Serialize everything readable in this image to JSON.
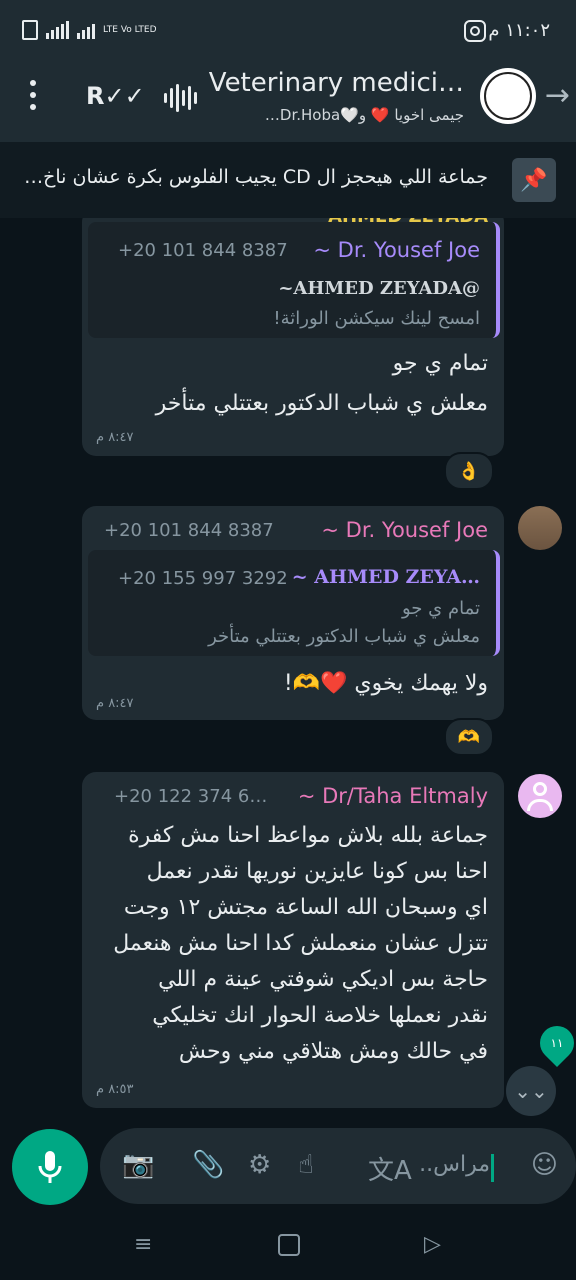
{
  "statusbar": {
    "time": "١١:٠٢ م",
    "network": "LTE Vo LTED"
  },
  "header": {
    "title": "Veterinary medici…",
    "subtitle": "جيمى اخويا ❤️ و🤍Dr.Hoba…"
  },
  "pinned": {
    "text": "جماعة اللي هيحجز ال CD يجيب الفلوس بكرة عشان ناخ…"
  },
  "messages": [
    {
      "cut_sender": "AHMED ZEYADA",
      "quote_sender": "~ Dr. Yousef Joe",
      "quote_phone": "+20 101 844 8387",
      "quote_mention": "~AHMED ZEYADA@",
      "quote_text": "امسح لينك سيكشن الوراثة!",
      "line1": "تمام ي جو",
      "line2": "معلش ي شباب الدكتور بعتتلي متأخر",
      "time": "٨:٤٧ م",
      "reaction": "👌"
    },
    {
      "sender": "~ Dr. Yousef Joe",
      "phone": "+20 101 844 8387",
      "quote_sender": "~ AHMED ZEYA…",
      "quote_phone": "+20 155 997 3292",
      "quote_line1": "تمام ي جو",
      "quote_line2": "معلش ي شباب الدكتور بعتتلي متأخر",
      "text": "ولا يهمك يخوي ❤️🫶!",
      "time": "٨:٤٧ م",
      "reaction": "🫶"
    },
    {
      "sender": "~ Dr/Taha Eltmaly",
      "phone": "+20 122 374 6…",
      "lines": [
        "جماعة بلله بلاش مواعظ احنا مش كفرة",
        "احنا بس كونا عايزين نوريها نقدر نعمل",
        "اي وسبحان الله الساعة مجتش ١٢ وجت",
        "تتزل عشان منعملش كدا احنا مش هنعمل",
        "حاجة بس اديكي شوفتي عينة م اللي",
        "نقدر نعملها خلاصة الحوار انك تخليكي",
        "في حالك ومش هتلاقي مني وحش"
      ],
      "time": "٨:٥٣ م"
    }
  ],
  "unread_count": "١١",
  "composer": {
    "placeholder": "مراس.."
  },
  "colors": {
    "accent": "#00a884",
    "bubble": "#202c33",
    "chat_bg": "#0b141a",
    "quote_bar": "#a78bfa",
    "sender_pink": "#e879b9",
    "sender_blue": "#53bdeb"
  }
}
